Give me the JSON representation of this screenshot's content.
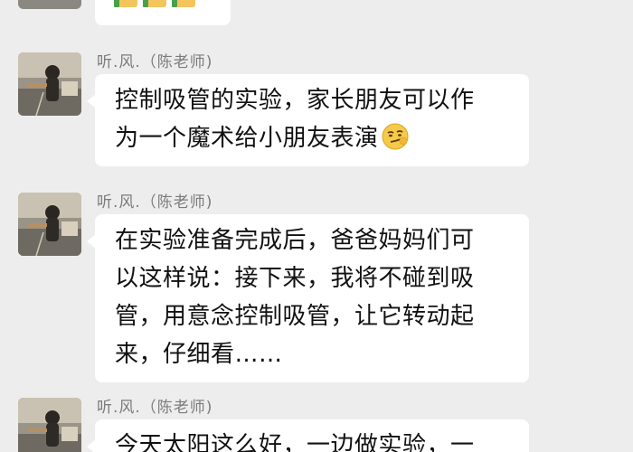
{
  "previous_message": {
    "emoji": [
      "thumbs-up",
      "thumbs-up",
      "thumbs-up"
    ]
  },
  "messages": [
    {
      "sender": "听.风.（陈老师)",
      "lines": [
        "控制吸管的实验，家长朋友可以作",
        "为一个魔术给小朋友表演"
      ],
      "trailing_emoji": "smirk-emoji"
    },
    {
      "sender": "听.风.（陈老师)",
      "lines": [
        "在实验准备完成后，爸爸妈妈们可",
        "以这样说：接下来，我将不碰到吸",
        "管，用意念控制吸管，让它转动起",
        "来，仔细看……"
      ]
    },
    {
      "sender": "听.风.（陈老师)",
      "lines": [
        "今天太阳这么好，一边做实验，一"
      ]
    }
  ],
  "colors": {
    "background": "#ededed",
    "bubble": "#ffffff",
    "sender_text": "#7b7b7b",
    "message_text": "#111111"
  }
}
